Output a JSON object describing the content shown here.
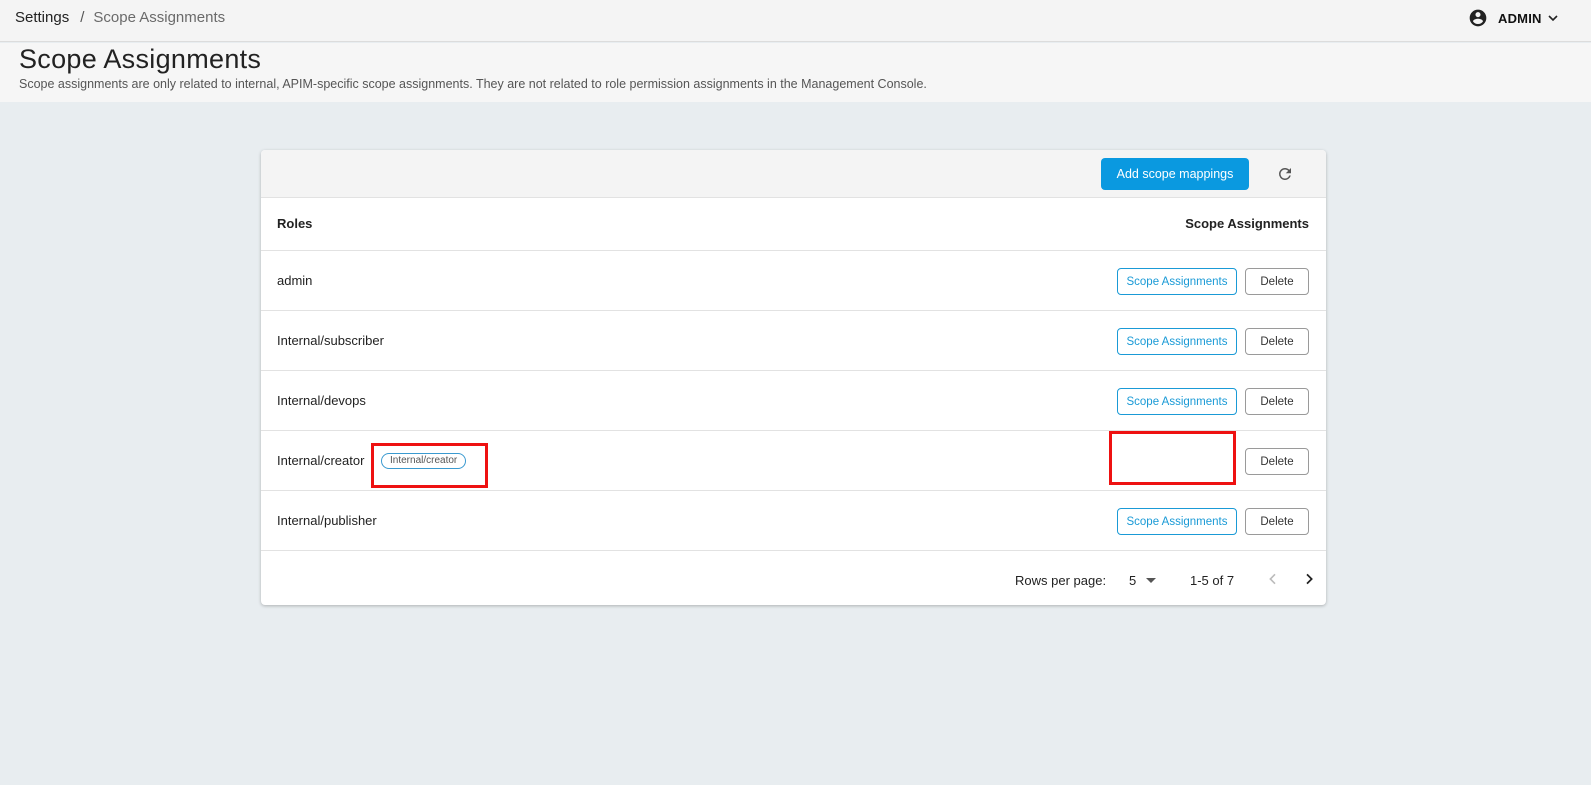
{
  "breadcrumb": {
    "parent": "Settings",
    "separator": "/",
    "current": "Scope Assignments"
  },
  "user": {
    "name": "ADMIN",
    "avatar_icon": "account-circle-icon",
    "menu_icon": "chevron-down-icon"
  },
  "header": {
    "title": "Scope Assignments",
    "description": "Scope assignments are only related to internal, APIM-specific scope assignments. They are not related to role permission assignments in the Management Console."
  },
  "toolbar": {
    "add_label": "Add scope mappings",
    "refresh_icon": "refresh-icon"
  },
  "table": {
    "headers": {
      "roles": "Roles",
      "scope_assignments": "Scope Assignments"
    },
    "rows": [
      {
        "role": "admin",
        "scope_label": "Scope Assignments",
        "delete_label": "Delete"
      },
      {
        "role": "Internal/subscriber",
        "scope_label": "Scope Assignments",
        "delete_label": "Delete"
      },
      {
        "role": "Internal/devops",
        "scope_label": "Scope Assignments",
        "delete_label": "Delete"
      },
      {
        "role": "Internal/creator",
        "chip": "Internal/creator",
        "delete_label": "Delete"
      },
      {
        "role": "Internal/publisher",
        "scope_label": "Scope Assignments",
        "delete_label": "Delete"
      }
    ]
  },
  "pagination": {
    "rows_per_page_label": "Rows per page:",
    "rows_per_page": "5",
    "range": "1-5 of 7",
    "prev_icon": "chevron-left-icon",
    "next_icon": "chevron-right-icon"
  },
  "colors": {
    "primary": "#0a99e0",
    "annotation": "#ee1111",
    "background": "#e8edf0"
  }
}
